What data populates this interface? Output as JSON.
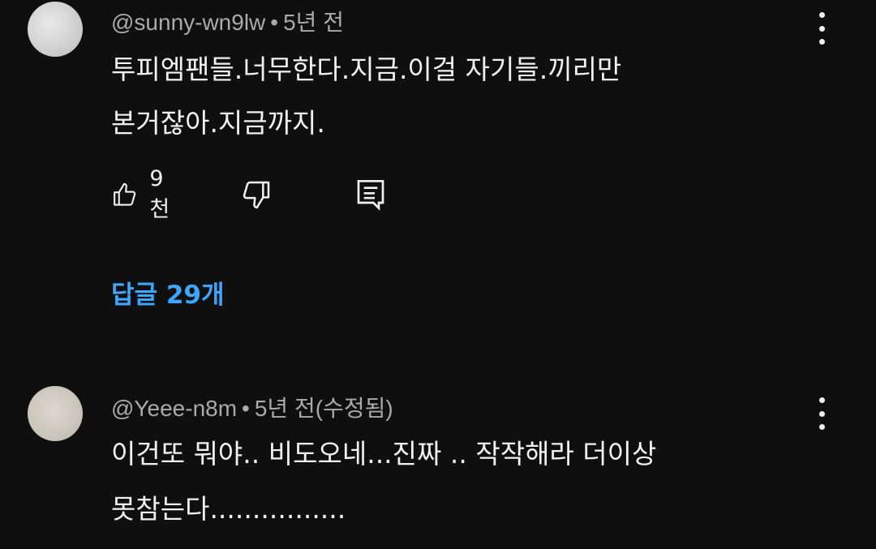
{
  "comments": [
    {
      "author": "@sunny-wn9lw",
      "separator": "•",
      "time": "5년 전",
      "lines": [
        "투피엠팬들.너무한다.지금.이걸 자기들.끼리만",
        "본거잖아.지금까지."
      ],
      "likes": "9천",
      "replies_label": "답글 29개",
      "icons": {
        "more": "more-vert-icon",
        "like": "thumb-up-icon",
        "dislike": "thumb-down-icon",
        "reply": "reply-comment-icon"
      }
    },
    {
      "author": "@Yeee-n8m",
      "separator": "•",
      "time": "5년 전(수정됨)",
      "lines": [
        "이건또 뭐야.. 비도오네...진짜 .. 작작해라 더이상",
        "못참는다................"
      ]
    }
  ],
  "colors": {
    "background": "#0f0f0f",
    "text": "#f1f1f1",
    "meta": "#aaaaaa",
    "link": "#3ea6ff"
  }
}
